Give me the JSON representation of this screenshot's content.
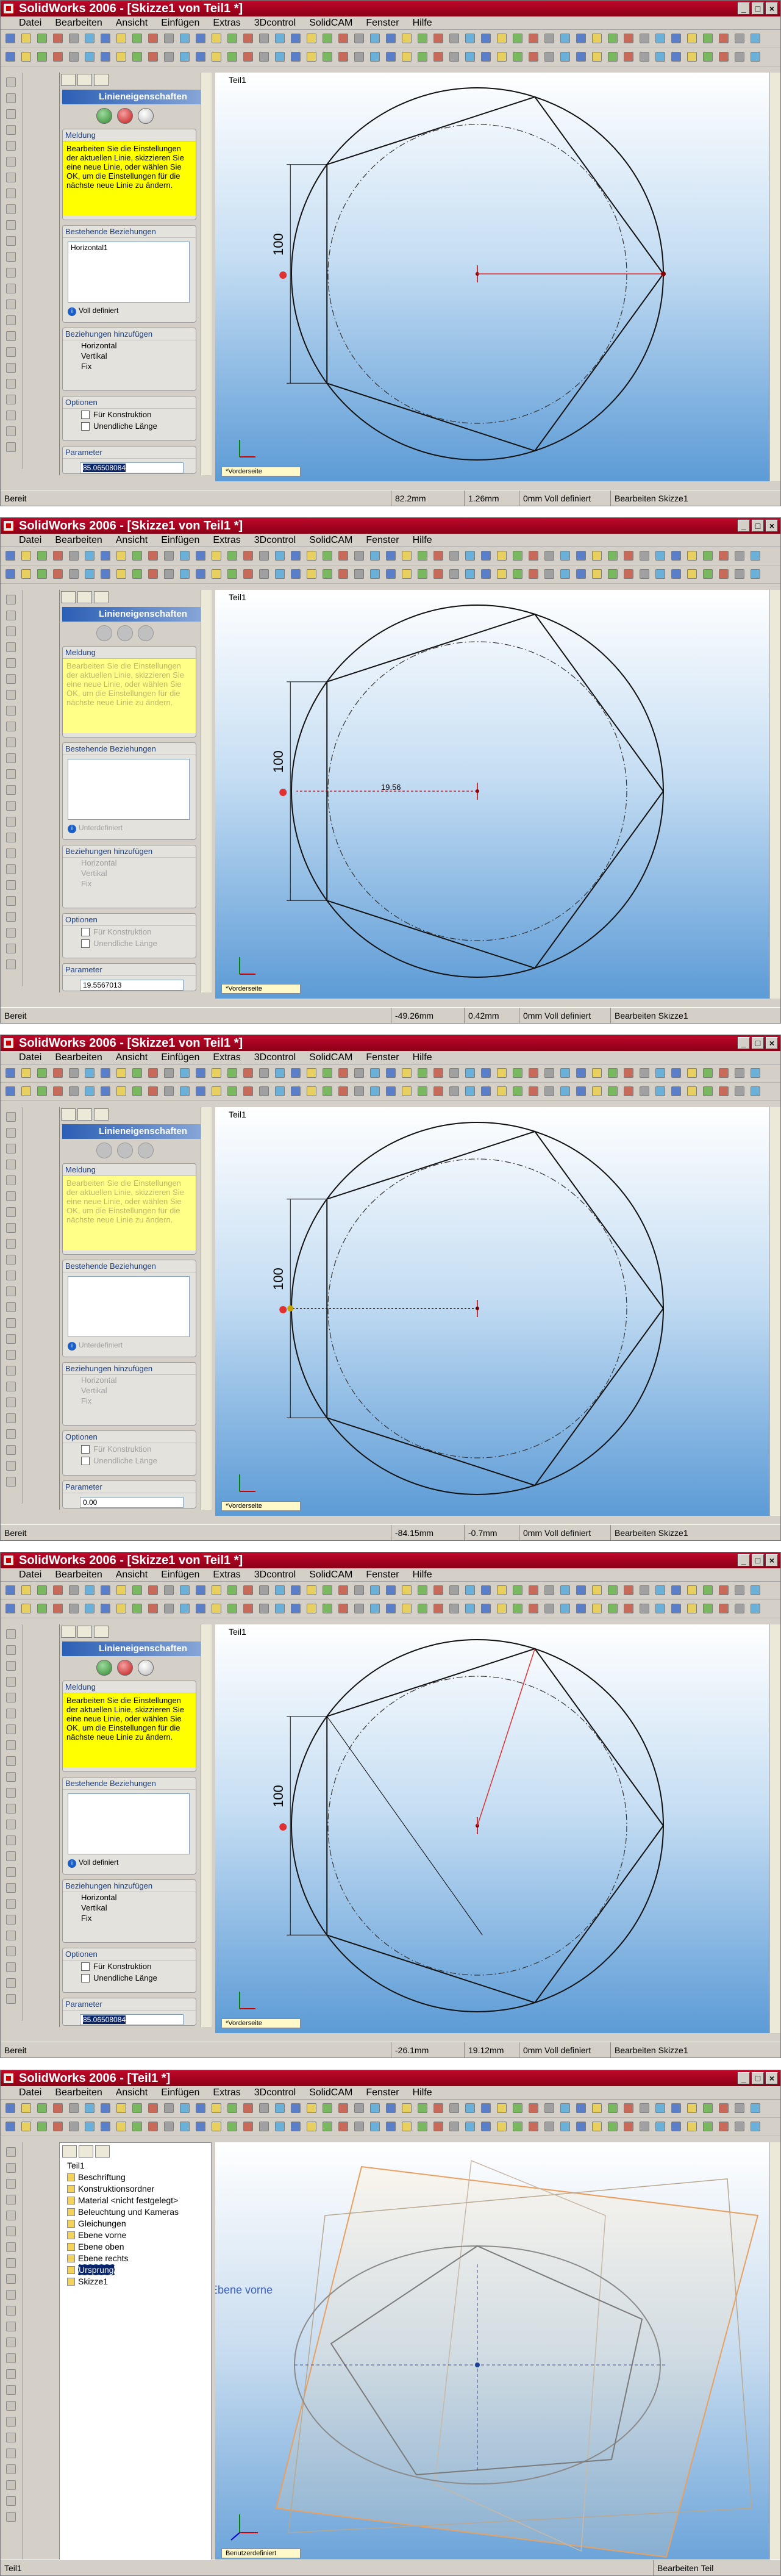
{
  "app": {
    "title_prefix": "SolidWorks 2006 - "
  },
  "menu": [
    "Datei",
    "Bearbeiten",
    "Ansicht",
    "Einfügen",
    "Extras",
    "3Dcontrol",
    "SolidCAM",
    "Fenster",
    "Hilfe"
  ],
  "common": {
    "pm_title": "Linieneigenschaften",
    "sec_meldung": "Meldung",
    "meldung": "Bearbeiten Sie die Einstellungen der aktuellen Linie, skizzieren Sie eine neue Linie, oder wählen Sie OK, um die Einstellungen für die nächste neue Linie zu ändern.",
    "sec_best": "Bestehende Beziehungen",
    "sec_hinzu": "Beziehungen hinzufügen",
    "rel_h": "Horizontal",
    "rel_v": "Vertikal",
    "rel_fix": "Fix",
    "sec_opt": "Optionen",
    "opt1": "Für Konstruktion",
    "opt2": "Unendliche Länge",
    "sec_param": "Parameter",
    "canvas_label": "Teil1",
    "dim_label": "100",
    "view_tab": "*Vorderseite",
    "status_ready": "Bereit",
    "status_def": "0mm Voll definiert",
    "status_edit": "Bearbeiten Skizze1"
  },
  "frames": [
    {
      "title": "[Skizze1 von Teil1 *]",
      "relation": "Horizontal1",
      "def_state": "Voll definiert",
      "param": "85.06508084",
      "x": "82.2mm",
      "y": "1.26mm",
      "pm_active": true
    },
    {
      "title": "[Skizze1 von Teil1 *]",
      "relation": "",
      "def_state": "Unterdefiniert",
      "param": "19.5567013",
      "x": "-49.26mm",
      "y": "0.42mm",
      "pm_active": false,
      "length_tag": "19.56"
    },
    {
      "title": "[Skizze1 von Teil1 *]",
      "relation": "",
      "def_state": "Unterdefiniert",
      "param": "0.00",
      "x": "-84.15mm",
      "y": "-0.7mm",
      "pm_active": false
    },
    {
      "title": "[Skizze1 von Teil1 *]",
      "relation": "",
      "def_state": "Voll definiert",
      "param": "85.06508084",
      "x": "-26.1mm",
      "y": "19.12mm",
      "pm_active": true
    }
  ],
  "final": {
    "title": "[Teil1 *]",
    "tree": [
      "Teil1",
      "Beschriftung",
      "Konstruktionsordner",
      "Material <nicht festgelegt>",
      "Beleuchtung und Kameras",
      "Gleichungen",
      "Ebene vorne",
      "Ebene oben",
      "Ebene rechts",
      "Ursprung",
      "Skizze1"
    ],
    "plane_label": "Ebene vorne",
    "view_tab": "Benutzerdefiniert",
    "status_left": "Teil1",
    "status_edit": "Bearbeiten Teil"
  }
}
